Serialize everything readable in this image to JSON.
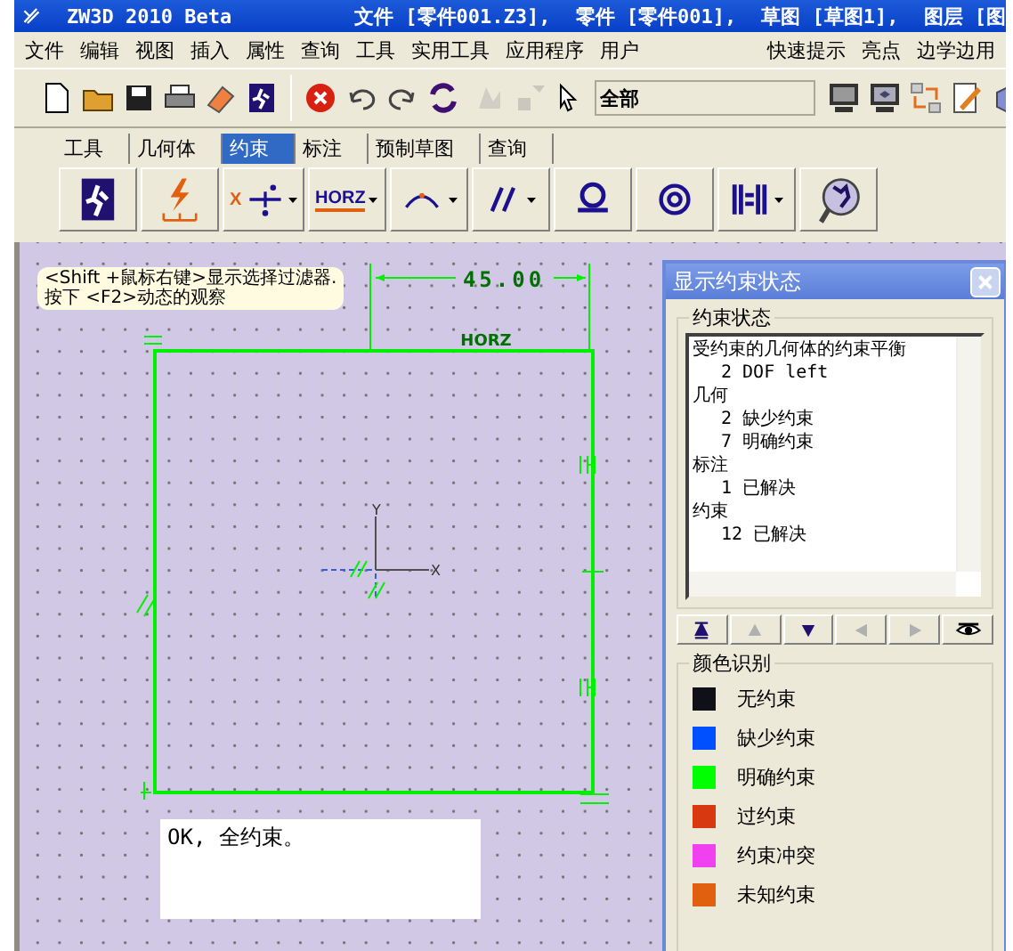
{
  "window": {
    "app": "ZW3D 2010 Beta",
    "title_parts": [
      "文件 [零件001.Z3],",
      "零件 [零件001],",
      "草图 [草图1],",
      "图层 [图"
    ]
  },
  "menu": {
    "items": [
      "文件",
      "编辑",
      "视图",
      "插入",
      "属性",
      "查询",
      "工具",
      "实用工具",
      "应用程序",
      "用户"
    ],
    "right_items": [
      "快速提示",
      "亮点",
      "边学边用"
    ]
  },
  "toolbar": {
    "buttons": [
      {
        "kind": "new",
        "disabled": false
      },
      {
        "kind": "open",
        "disabled": false
      },
      {
        "kind": "save",
        "disabled": false
      },
      {
        "kind": "print",
        "disabled": false
      },
      {
        "kind": "eraser",
        "disabled": false
      },
      {
        "kind": "exit",
        "disabled": false
      },
      {
        "kind": "cancel",
        "disabled": false
      },
      {
        "kind": "undo",
        "disabled": false
      },
      {
        "kind": "redo",
        "disabled": false
      },
      {
        "kind": "cycle",
        "disabled": false
      },
      {
        "kind": "pick",
        "disabled": true
      },
      {
        "kind": "filter",
        "disabled": true
      },
      {
        "kind": "cursor",
        "disabled": false
      }
    ],
    "filter_value": "全部",
    "right_buttons": [
      {
        "kind": "monitor"
      },
      {
        "kind": "monitor-box"
      },
      {
        "kind": "arrows"
      },
      {
        "kind": "pencil"
      },
      {
        "kind": "box"
      }
    ]
  },
  "tabs": [
    {
      "label": "工具",
      "selected": false
    },
    {
      "label": "几何体",
      "selected": false
    },
    {
      "label": "约束",
      "selected": true
    },
    {
      "label": "标注",
      "selected": false
    },
    {
      "label": "预制草图",
      "selected": false
    },
    {
      "label": "查询",
      "selected": false
    }
  ],
  "constraint_buttons": [
    {
      "kind": "exit",
      "dropdown": false
    },
    {
      "kind": "bolt",
      "dropdown": false
    },
    {
      "kind": "point",
      "label": "X",
      "dropdown": true
    },
    {
      "kind": "text",
      "label": "HORZ",
      "dropdown": true
    },
    {
      "kind": "arc",
      "dropdown": true
    },
    {
      "kind": "parallel",
      "dropdown": true
    },
    {
      "kind": "tangent",
      "dropdown": false
    },
    {
      "kind": "concentric",
      "dropdown": false
    },
    {
      "kind": "equal",
      "dropdown": true
    },
    {
      "kind": "globe",
      "dropdown": false
    }
  ],
  "canvas": {
    "hint": "<Shift +鼠标右键>显示选择过滤器.\n按下 <F2>动态的观察",
    "dimension": "45.00",
    "horz_label": "HORZ",
    "axis_x": "X",
    "axis_y": "Y",
    "message": "OK, 全约束。"
  },
  "panel": {
    "title": "显示约束状态",
    "status_group": "约束状态",
    "status_tree": [
      {
        "text": "受约束的几何体的约束平衡",
        "children": [
          {
            "text": "2 DOF left"
          }
        ]
      },
      {
        "text": "几何",
        "children": [
          {
            "text": "2 缺少约束"
          },
          {
            "text": "7 明确约束"
          }
        ]
      },
      {
        "text": "标注",
        "children": [
          {
            "text": "1 已解决"
          }
        ]
      },
      {
        "text": "约束",
        "children": [
          {
            "text": "12 已解决"
          }
        ]
      }
    ],
    "nav_buttons": [
      {
        "kind": "first",
        "disabled": false
      },
      {
        "kind": "up",
        "disabled": true
      },
      {
        "kind": "down",
        "disabled": false
      },
      {
        "kind": "left",
        "disabled": true
      },
      {
        "kind": "right",
        "disabled": true
      },
      {
        "kind": "eye",
        "disabled": false
      }
    ],
    "legend_group": "颜色识别",
    "legend": [
      {
        "label": "无约束",
        "color": "#101018"
      },
      {
        "label": "缺少约束",
        "color": "#0050ff"
      },
      {
        "label": "明确约束",
        "color": "#00ff00"
      },
      {
        "label": "过约束",
        "color": "#d83810"
      },
      {
        "label": "约束冲突",
        "color": "#f040f0"
      },
      {
        "label": "未知约束",
        "color": "#e06010"
      }
    ]
  }
}
